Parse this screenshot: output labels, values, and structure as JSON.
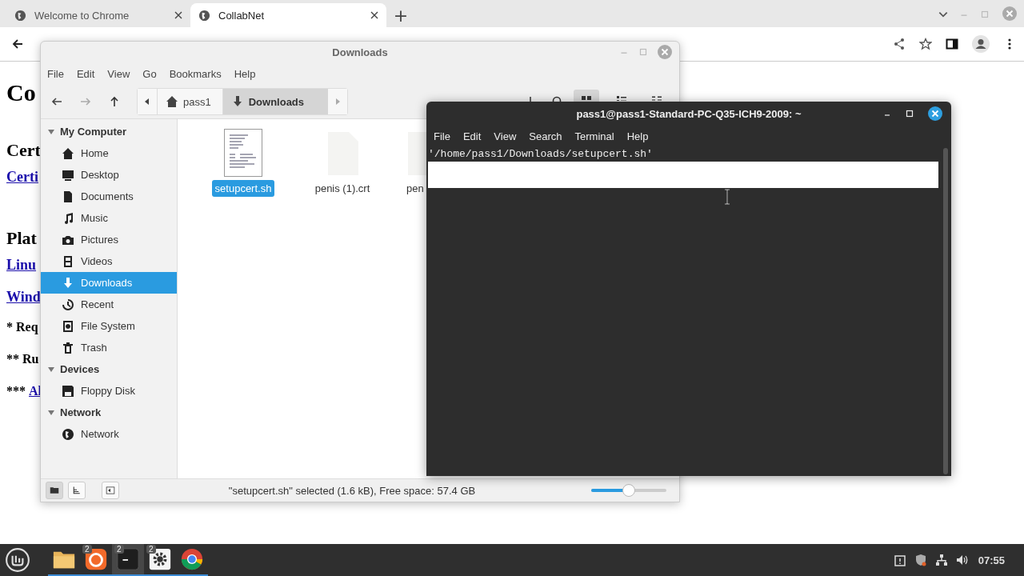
{
  "browser": {
    "tabs": [
      {
        "title": "Welcome to Chrome",
        "selected": false
      },
      {
        "title": "CollabNet",
        "selected": true
      }
    ],
    "new_tab": "+",
    "page": [
      {
        "kind": "h1",
        "text": "Co"
      },
      {
        "kind": "h2",
        "text": "Cert"
      },
      {
        "kind": "link",
        "text": "Certi"
      },
      {
        "kind": "h2",
        "text": "Plat"
      },
      {
        "kind": "link",
        "text": "Linu"
      },
      {
        "kind": "link",
        "text": "Wind"
      },
      {
        "kind": "note",
        "text": "* Req"
      },
      {
        "kind": "note",
        "text": "** Ru"
      },
      {
        "kind": "note",
        "text": "***",
        "link": "Al"
      }
    ]
  },
  "file_manager": {
    "title": "Downloads",
    "menu": [
      "File",
      "Edit",
      "View",
      "Go",
      "Bookmarks",
      "Help"
    ],
    "breadcrumb": [
      {
        "label": "pass1",
        "selected": false
      },
      {
        "label": "Downloads",
        "selected": true
      }
    ],
    "sidebar": [
      {
        "title": "My Computer",
        "expanded": true,
        "children": [
          {
            "label": "Home",
            "selected": false
          },
          {
            "label": "Desktop",
            "selected": false
          },
          {
            "label": "Documents",
            "selected": false
          },
          {
            "label": "Music",
            "selected": false
          },
          {
            "label": "Pictures",
            "selected": false
          },
          {
            "label": "Videos",
            "selected": false
          },
          {
            "label": "Downloads",
            "selected": true
          },
          {
            "label": "Recent",
            "selected": false
          },
          {
            "label": "File System",
            "selected": false
          },
          {
            "label": "Trash",
            "selected": false
          }
        ]
      },
      {
        "title": "Devices",
        "expanded": true,
        "children": [
          {
            "label": "Floppy Disk",
            "selected": false
          }
        ]
      },
      {
        "title": "Network",
        "expanded": true,
        "children": [
          {
            "label": "Network",
            "selected": false
          }
        ]
      }
    ],
    "files": [
      {
        "name": "setupcert.sh",
        "kind": "text",
        "selected": true
      },
      {
        "name": "penis (1).crt",
        "kind": "blank",
        "selected": false
      },
      {
        "name": "pen",
        "kind": "blank",
        "selected": false
      }
    ],
    "status": "\"setupcert.sh\" selected (1.6 kB), Free space: 57.4 GB",
    "zoom": {
      "level": 0.5
    }
  },
  "terminal": {
    "title": "pass1@pass1-Standard-PC-Q35-ICH9-2009: ~",
    "menu": [
      "File",
      "Edit",
      "View",
      "Search",
      "Terminal",
      "Help"
    ],
    "lines": [
      "'/home/pass1/Downloads/setupcert.sh'"
    ]
  },
  "taskbar": {
    "apps": [
      {
        "kind": "folder",
        "selected": false
      },
      {
        "kind": "orange",
        "badge": "2",
        "selected": false
      },
      {
        "kind": "terminal",
        "badge": "2",
        "selected": true
      },
      {
        "kind": "settings",
        "badge": "2",
        "selected": false
      },
      {
        "kind": "browser",
        "selected": false
      }
    ],
    "clock": "07:55"
  }
}
